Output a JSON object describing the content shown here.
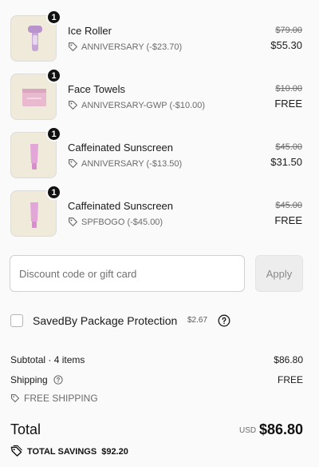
{
  "items": [
    {
      "quantity": "1",
      "name": "Ice Roller",
      "discount": "ANNIVERSARY (-$23.70)",
      "original_price": "$79.00",
      "price": "$55.30",
      "image": "ice-roller-image"
    },
    {
      "quantity": "1",
      "name": "Face Towels",
      "discount": "ANNIVERSARY-GWP (-$10.00)",
      "original_price": "$10.00",
      "price": "FREE",
      "image": "face-towels-image"
    },
    {
      "quantity": "1",
      "name": "Caffeinated Sunscreen",
      "discount": "ANNIVERSARY (-$13.50)",
      "original_price": "$45.00",
      "price": "$31.50",
      "image": "sunscreen-image"
    },
    {
      "quantity": "1",
      "name": "Caffeinated Sunscreen",
      "discount": "SPFBOGO (-$45.00)",
      "original_price": "$45.00",
      "price": "FREE",
      "image": "sunscreen-image"
    }
  ],
  "discount_form": {
    "placeholder": "Discount code or gift card",
    "value": "",
    "apply_label": "Apply"
  },
  "protection": {
    "checked": false,
    "label": "SavedBy Package Protection",
    "price": "$2.67"
  },
  "summary": {
    "subtotal_label": "Subtotal · 4 items",
    "subtotal_value": "$86.80",
    "shipping_label": "Shipping",
    "shipping_value": "FREE",
    "shipping_discount": "FREE SHIPPING",
    "total_label": "Total",
    "currency": "USD",
    "total_value": "$86.80",
    "savings_label": "TOTAL SAVINGS",
    "savings_value": "$92.20"
  },
  "colors": {
    "thumb_background": "#efead9",
    "product_lavender": "#c9a8d8",
    "product_pink": "#e3a6d9"
  }
}
